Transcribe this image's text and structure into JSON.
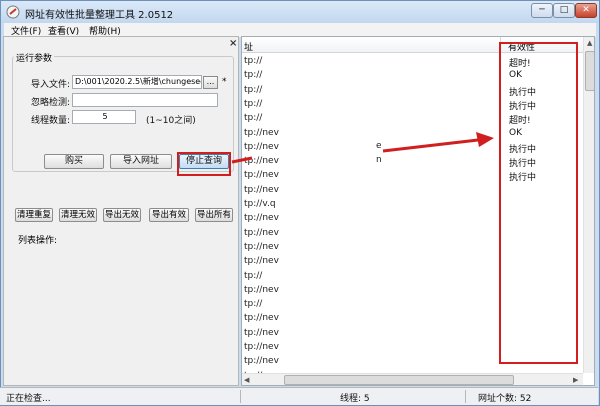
{
  "window": {
    "title": "网址有效性批量整理工具 2.0512",
    "min_label": "─",
    "max_label": "□",
    "close_label": "✕"
  },
  "menu": [
    "文件(F)",
    "查看(V)",
    "帮助(H)"
  ],
  "panel": {
    "close_label": "×",
    "group_title": "运行参数",
    "import_file_label": "导入文件:",
    "import_file_value": "D:\\001\\2020.2.5\\新增\\chungeseo.",
    "browse_label": "...",
    "asterisk": "*",
    "ignore_label": "忽略检测:",
    "ignore_value": "",
    "threads_label": "线程数量:",
    "threads_value": "5",
    "threads_hint": "(1~10之间)"
  },
  "actions": {
    "buy": "购买",
    "import_urls": "导入网址",
    "stop_query": "停止查询"
  },
  "list_ops": {
    "label": "列表操作:",
    "buttons": [
      "清理重复",
      "清理无效",
      "导出无效",
      "导出有效",
      "导出所有"
    ]
  },
  "list": {
    "col_url": "址",
    "col_valid": "有效性",
    "rows": [
      {
        "url": "tp://",
        "status": "超时!"
      },
      {
        "url": "tp://",
        "status": "OK"
      },
      {
        "url": "tp://",
        "status": "执行中"
      },
      {
        "url": "tp://",
        "status": "执行中"
      },
      {
        "url": "tp://",
        "status": "超时!"
      },
      {
        "url": "tp://nev",
        "status": "OK"
      },
      {
        "url": "tp://nev",
        "status": "执行中"
      },
      {
        "url": "tp://nev",
        "status": "执行中"
      },
      {
        "url": "tp://nev",
        "status": "执行中"
      },
      {
        "url": "tp://nev",
        "status": ""
      },
      {
        "url": "tp://v.q",
        "status": ""
      },
      {
        "url": "tp://nev",
        "status": ""
      },
      {
        "url": "tp://nev",
        "status": ""
      },
      {
        "url": "tp://nev",
        "status": ""
      },
      {
        "url": "tp://nev",
        "status": ""
      },
      {
        "url": "tp://",
        "status": ""
      },
      {
        "url": "tp://nev",
        "status": ""
      },
      {
        "url": "tp://",
        "status": ""
      },
      {
        "url": "tp://nev",
        "status": ""
      },
      {
        "url": "tp://nev",
        "status": ""
      },
      {
        "url": "tp://nev",
        "status": ""
      },
      {
        "url": "tp://nev",
        "status": ""
      },
      {
        "url": "tp://nev",
        "status": ""
      }
    ],
    "fragments": [
      "e",
      "n"
    ]
  },
  "statusbar": {
    "state": "正在检查...",
    "threads": "线程: 5",
    "count": "网址个数: 52"
  },
  "colors": {
    "annotation": "#d11e1e",
    "window_frame": "#c9ddf2"
  }
}
